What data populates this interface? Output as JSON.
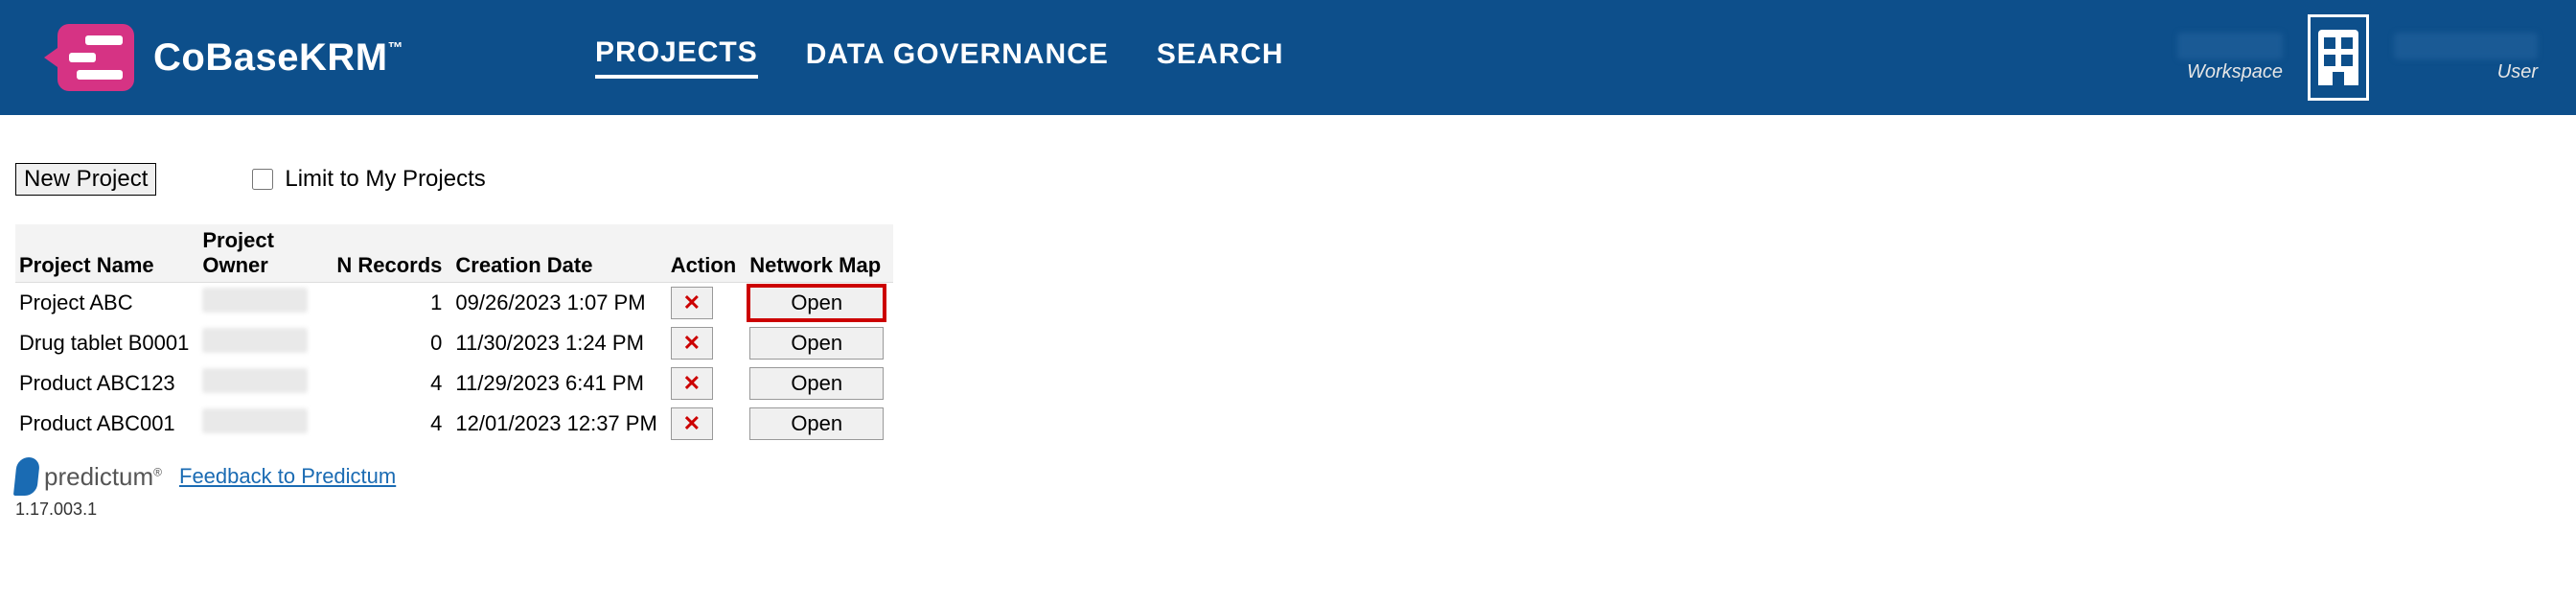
{
  "brand": {
    "name": "CoBaseKRM",
    "tm": "™"
  },
  "nav": {
    "projects": "PROJECTS",
    "data_governance": "DATA GOVERNANCE",
    "search": "SEARCH"
  },
  "header_right": {
    "workspace_label": "Workspace",
    "user_label": "User"
  },
  "toolbar": {
    "new_project": "New Project",
    "limit_label": "Limit to My Projects"
  },
  "table": {
    "headers": {
      "project_name": "Project Name",
      "project_owner": "Project Owner",
      "n_records": "N Records",
      "creation_date": "Creation Date",
      "action": "Action",
      "network_map": "Network Map"
    },
    "open_label": "Open",
    "rows": [
      {
        "name": "Project ABC",
        "n": "1",
        "date": "09/26/2023 1:07 PM",
        "highlight": true
      },
      {
        "name": "Drug tablet B0001",
        "n": "0",
        "date": "11/30/2023 1:24 PM",
        "highlight": false
      },
      {
        "name": "Product ABC123",
        "n": "4",
        "date": "11/29/2023 6:41 PM",
        "highlight": false
      },
      {
        "name": "Product ABC001",
        "n": "4",
        "date": "12/01/2023 12:37 PM",
        "highlight": false
      }
    ]
  },
  "footer": {
    "predictum": "predictum",
    "reg": "®",
    "feedback": "Feedback to Predictum",
    "version": "1.17.003.1"
  }
}
